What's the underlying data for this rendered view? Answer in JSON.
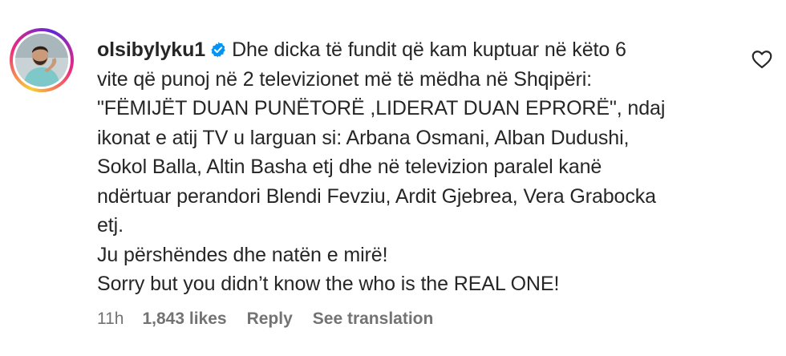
{
  "comment": {
    "username": "olsibylyku1",
    "verified_icon": "verified-badge-icon",
    "lines": [
      "Dhe dicka të fundit që kam kuptuar në këto 6",
      "vite që punoj në 2 televizionet më të mëdha në Shqipëri:",
      "\"FËMIJËT DUAN PUNËTORË ,LIDERAT DUAN EPRORË\", ndaj",
      "ikonat e atij TV u larguan si: Arbana Osmani, Alban Dudushi,",
      "Sokol Balla, Altin Basha etj dhe në televizion paralel kanë",
      "ndërtuar perandori Blendi Fevziu, Ardit Gjebrea, Vera Grabocka",
      "etj.",
      "Ju përshëndes dhe natën e mirë!",
      "Sorry but you didn’t know the who is the REAL ONE!"
    ],
    "time": "11h",
    "likes": "1,843 likes",
    "reply_label": "Reply",
    "translate_label": "See translation",
    "like_icon": "heart-outline-icon",
    "avatar_icon": "profile-avatar"
  },
  "colors": {
    "text": "#262626",
    "secondary": "#737373",
    "verified_blue": "#0095f6"
  }
}
